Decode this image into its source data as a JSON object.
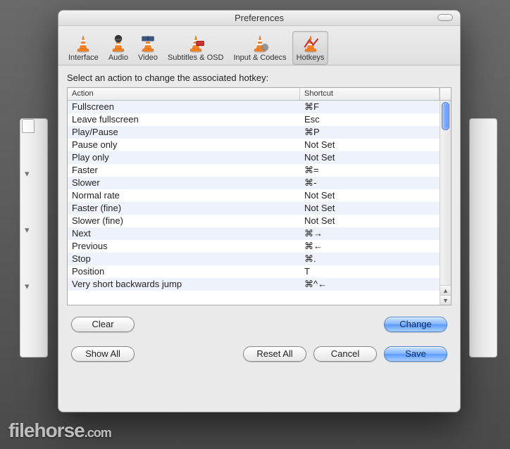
{
  "window": {
    "title": "Preferences"
  },
  "toolbar": {
    "items": [
      {
        "label": "Interface"
      },
      {
        "label": "Audio"
      },
      {
        "label": "Video"
      },
      {
        "label": "Subtitles & OSD"
      },
      {
        "label": "Input & Codecs"
      },
      {
        "label": "Hotkeys"
      }
    ],
    "selected_index": 5
  },
  "prompt": "Select an action to change the associated hotkey:",
  "table": {
    "headers": {
      "action": "Action",
      "shortcut": "Shortcut"
    },
    "rows": [
      {
        "action": "Fullscreen",
        "shortcut": "⌘F"
      },
      {
        "action": "Leave fullscreen",
        "shortcut": "Esc"
      },
      {
        "action": "Play/Pause",
        "shortcut": "⌘P"
      },
      {
        "action": "Pause only",
        "shortcut": "Not Set"
      },
      {
        "action": "Play only",
        "shortcut": "Not Set"
      },
      {
        "action": "Faster",
        "shortcut": "⌘="
      },
      {
        "action": "Slower",
        "shortcut": "⌘-"
      },
      {
        "action": "Normal rate",
        "shortcut": "Not Set"
      },
      {
        "action": "Faster (fine)",
        "shortcut": "Not Set"
      },
      {
        "action": "Slower (fine)",
        "shortcut": "Not Set"
      },
      {
        "action": "Next",
        "shortcut": "⌘→"
      },
      {
        "action": "Previous",
        "shortcut": "⌘←"
      },
      {
        "action": "Stop",
        "shortcut": "⌘."
      },
      {
        "action": "Position",
        "shortcut": "T"
      },
      {
        "action": "Very short backwards jump",
        "shortcut": "⌘^←"
      }
    ]
  },
  "buttons": {
    "clear": "Clear",
    "change": "Change",
    "show_all": "Show All",
    "reset_all": "Reset All",
    "cancel": "Cancel",
    "save": "Save"
  },
  "watermark": "filehorse.com"
}
